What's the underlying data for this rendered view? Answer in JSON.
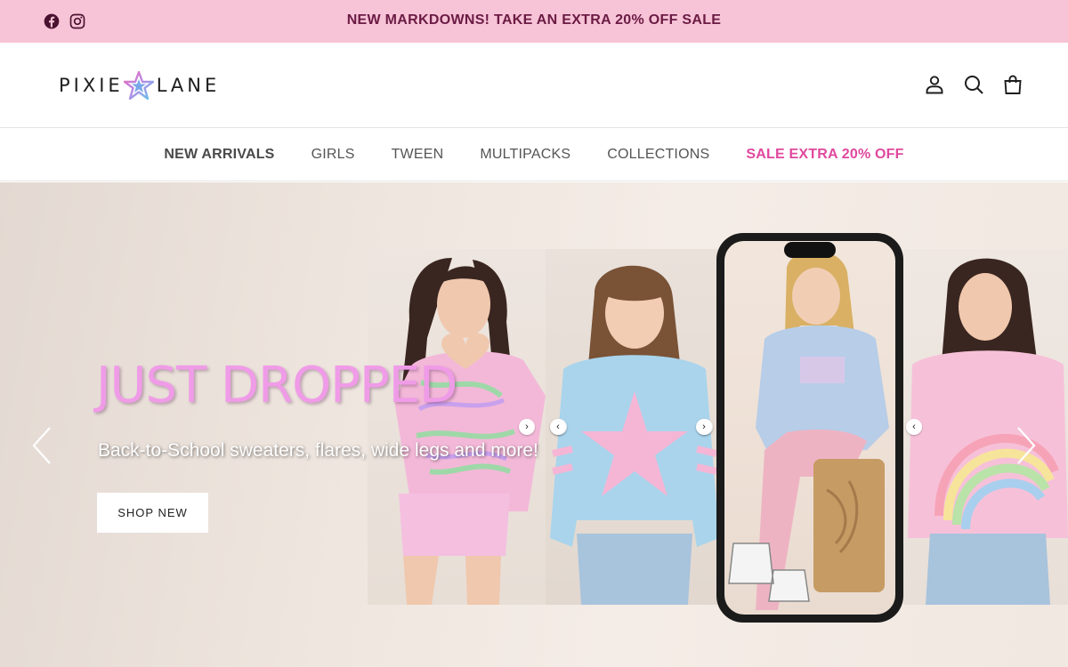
{
  "announcement": {
    "text": "NEW MARKDOWNS! TAKE AN EXTRA 20% OFF SALE",
    "background": "#f7c3d6",
    "text_color": "#6b1b44",
    "social_icons": [
      "facebook-icon",
      "instagram-icon"
    ]
  },
  "header": {
    "logo_left": "PIXIE",
    "logo_right": "LANE",
    "icons": [
      "account-icon",
      "search-icon",
      "bag-icon"
    ]
  },
  "nav": {
    "items": [
      {
        "label": "NEW ARRIVALS"
      },
      {
        "label": "GIRLS"
      },
      {
        "label": "TWEEN"
      },
      {
        "label": "MULTIPACKS"
      },
      {
        "label": "COLLECTIONS"
      },
      {
        "label": "SALE EXTRA 20% OFF"
      }
    ],
    "sale_color": "#e0489e"
  },
  "hero": {
    "title": "JUST DROPPED",
    "subtitle": "Back-to-School sweaters, flares, wide legs and more!",
    "button_label": "SHOP NEW",
    "title_color": "#f09be8",
    "prev_icon": "chevron-left-icon",
    "next_icon": "chevron-right-icon",
    "panel_arrow_left": "‹",
    "panel_arrow_right": "›"
  }
}
